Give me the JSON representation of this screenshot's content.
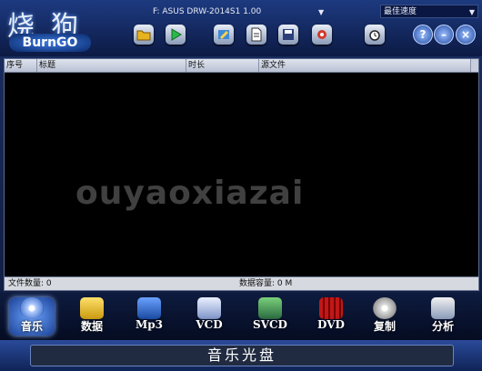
{
  "app": {
    "logo_cn": "烧狗",
    "logo_en": "BurnGO"
  },
  "drive": {
    "label": "F: ASUS    DRW-2014S1     1.00"
  },
  "speed": {
    "selected": "最佳速度"
  },
  "toolbar": [
    {
      "name": "open-folder-icon"
    },
    {
      "name": "play-icon"
    },
    {
      "name": "edit-icon"
    },
    {
      "name": "new-document-icon"
    },
    {
      "name": "save-icon"
    },
    {
      "name": "settings-icon"
    },
    {
      "name": "alarm-clock-icon"
    }
  ],
  "window_buttons": {
    "help": "?",
    "minimize": "–",
    "close": "×"
  },
  "list": {
    "columns": [
      "序号",
      "标题",
      "时长",
      "源文件"
    ],
    "rows": [],
    "watermark": "ouyaoxiazai"
  },
  "status": {
    "file_count": "文件数量: 0",
    "capacity": "数据容量: 0 M"
  },
  "modes": [
    {
      "label": "音乐",
      "icon": "disc-icon",
      "active": true
    },
    {
      "label": "数据",
      "icon": "data-folder-icon"
    },
    {
      "label": "Mp3",
      "icon": "mp3-icon"
    },
    {
      "label": "VCD",
      "icon": "vcd-icon"
    },
    {
      "label": "SVCD",
      "icon": "svcd-icon"
    },
    {
      "label": "DVD",
      "icon": "dvd-film-icon"
    },
    {
      "label": "复制",
      "icon": "copy-disc-icon"
    },
    {
      "label": "分析",
      "icon": "analyze-icon"
    }
  ],
  "footer": {
    "title": "音乐光盘"
  },
  "colors": {
    "accent": "#1d3a80",
    "list_bg": "#000000",
    "status_bg": "#d6d9e0"
  }
}
